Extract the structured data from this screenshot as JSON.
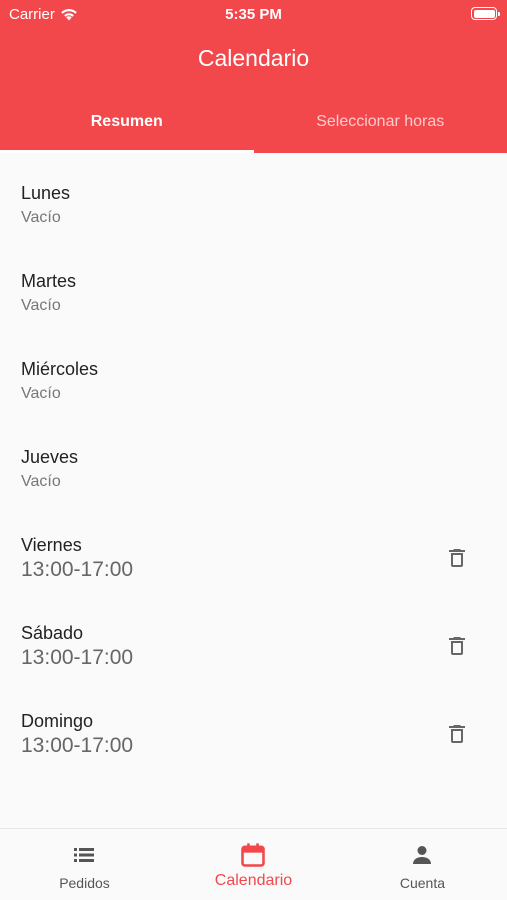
{
  "status_bar": {
    "carrier": "Carrier",
    "time": "5:35 PM"
  },
  "header": {
    "title": "Calendario",
    "background_color": "#f2484b"
  },
  "tabs": [
    {
      "label": "Resumen",
      "active": true
    },
    {
      "label": "Seleccionar horas",
      "active": false
    }
  ],
  "days": [
    {
      "name": "Lunes",
      "value": "Vacío"
    },
    {
      "name": "Martes",
      "value": "Vacío"
    },
    {
      "name": "Miércoles",
      "value": "Vacío"
    },
    {
      "name": "Jueves",
      "value": "Vacío"
    },
    {
      "name": "Viernes",
      "value": "13:00-17:00",
      "icon": "trash-icon"
    },
    {
      "name": "Sábado",
      "value": "13:00-17:00",
      "icon": "trash-icon"
    },
    {
      "name": "Domingo",
      "value": "13:00-17:00",
      "icon": "trash-icon"
    }
  ],
  "bottom_nav": [
    {
      "label": "Pedidos",
      "icon": "list-icon",
      "active": false
    },
    {
      "label": "Calendario",
      "icon": "calendar-icon",
      "active": true
    },
    {
      "label": "Cuenta",
      "icon": "person-icon",
      "active": false
    }
  ]
}
